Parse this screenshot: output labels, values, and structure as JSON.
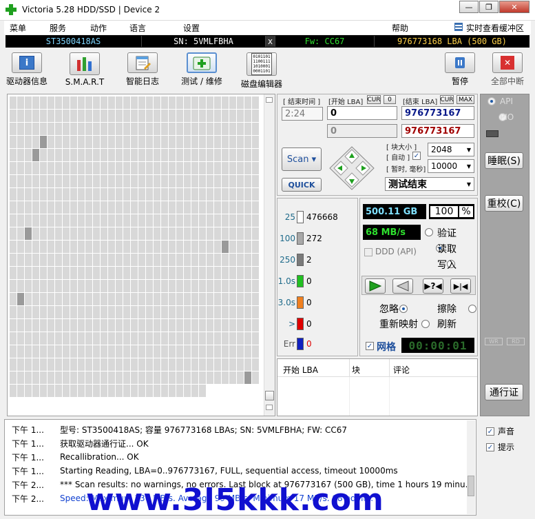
{
  "window": {
    "title": "Victoria 5.28 HDD/SSD | Device 2",
    "min_label": "—",
    "restore_label": "❐",
    "close_label": "✕"
  },
  "menu": {
    "items": [
      "菜单",
      "服务",
      "动作",
      "语言",
      "设置",
      "帮助"
    ],
    "buffer_label": "实时查看缓冲区"
  },
  "info": {
    "model": "ST3500418AS",
    "serial": "SN: 5VMLFBHA",
    "x": "x",
    "firmware": "Fw: CC67",
    "capacity": "976773168 LBA (500 GB)"
  },
  "toolbar": {
    "drive_info": "驱动器信息",
    "smart": "S.M.A.R.T",
    "smart_log": "智能日志",
    "test": "测试 / 维修",
    "disk_editor": "磁盘编辑器",
    "disk_editor_icon_text": "0101101\n1100111\n1010001\n0001101",
    "pause": "暂停",
    "abort": "全部中断"
  },
  "controls": {
    "end_time_label": "[ 结束时间 ]",
    "start_lba_label": "[开始 LBA]",
    "cur_label": "CUR",
    "zero_label": "0",
    "end_lba_label": "[结束 LBA]",
    "max_label": "MAX",
    "time_value": "2:24",
    "start_lba": "0",
    "end_lba": "976773167",
    "start_lba2": "0",
    "end_lba2": "976773167",
    "block_size_label": "[ 块大小 ]",
    "auto_label": "[ 自动 ]",
    "block_size": "2048",
    "timeout_label": "[ 暂时, 毫秒]",
    "timeout": "10000",
    "scan_label": "Scan",
    "quick_label": "QUICK",
    "status_combo": "测试结束"
  },
  "legend": {
    "items": [
      {
        "label": "25",
        "count": "476668",
        "color": "#ffffff"
      },
      {
        "label": "100",
        "count": "272",
        "color": "#a8a8a8"
      },
      {
        "label": "250",
        "count": "2",
        "color": "#7a7a7a"
      },
      {
        "label": "1.0s",
        "count": "0",
        "color": "#22c022"
      },
      {
        "label": "3.0s",
        "count": "0",
        "color": "#f08020"
      },
      {
        "label": ">",
        "count": "0",
        "color": "#e00000"
      },
      {
        "label": "Err",
        "count": "0",
        "color": "#1020c0"
      }
    ]
  },
  "stats": {
    "processed": "500.11 GB",
    "percent": "100",
    "percent_sign": "%",
    "speed": "68 MB/s",
    "ddd_label": "DDD (API)",
    "verify": "验证",
    "read": "读取",
    "write": "写入",
    "ignore": "忽略",
    "erase": "擦除",
    "remap": "重新映射",
    "refresh": "刷新",
    "grid_label": "网格",
    "timer": "00:00:01"
  },
  "table": {
    "headers": [
      "开始 LBA",
      "块",
      "评论"
    ]
  },
  "side": {
    "api": "API",
    "pio": "PIO",
    "sleep": "睡眠(S)",
    "recalibrate": "重校(C)",
    "wr": "WR",
    "rd": "RD",
    "passport": "通行证",
    "sound": "声音",
    "hints": "提示"
  },
  "log": {
    "rows": [
      {
        "time": "下午 1...",
        "msg": "型号: ST3500418AS; 容量 976773168 LBAs; SN: 5VMLFBHA; FW: CC67",
        "color": "#000000"
      },
      {
        "time": "下午 1...",
        "msg": "获取驱动器通行证... OK",
        "color": "#000000"
      },
      {
        "time": "下午 1...",
        "msg": "Recallibration... OK",
        "color": "#000000"
      },
      {
        "time": "下午 1...",
        "msg": "Starting Reading, LBA=0..976773167, FULL, sequential access, timeout 10000ms",
        "color": "#000000"
      },
      {
        "time": "下午 2...",
        "msg": "*** Scan results: no warnings, no errors. Last block at 976773167 (500 GB), time 1 hours 19 minu...",
        "color": "#000000"
      },
      {
        "time": "下午 2...",
        "msg": "Speed: Maximum 130 MB/s. Average 99 MB/s. Minimum 17 MB/s. 98 points.",
        "color": "#1040d0"
      }
    ]
  },
  "watermark": "www.3l5kkk.com",
  "colors": {
    "accent": "#1e5aa8",
    "model": "#7fd6ff",
    "serial": "#ffffff",
    "firmware": "#2ee02e",
    "capacity": "#ffd24a"
  }
}
